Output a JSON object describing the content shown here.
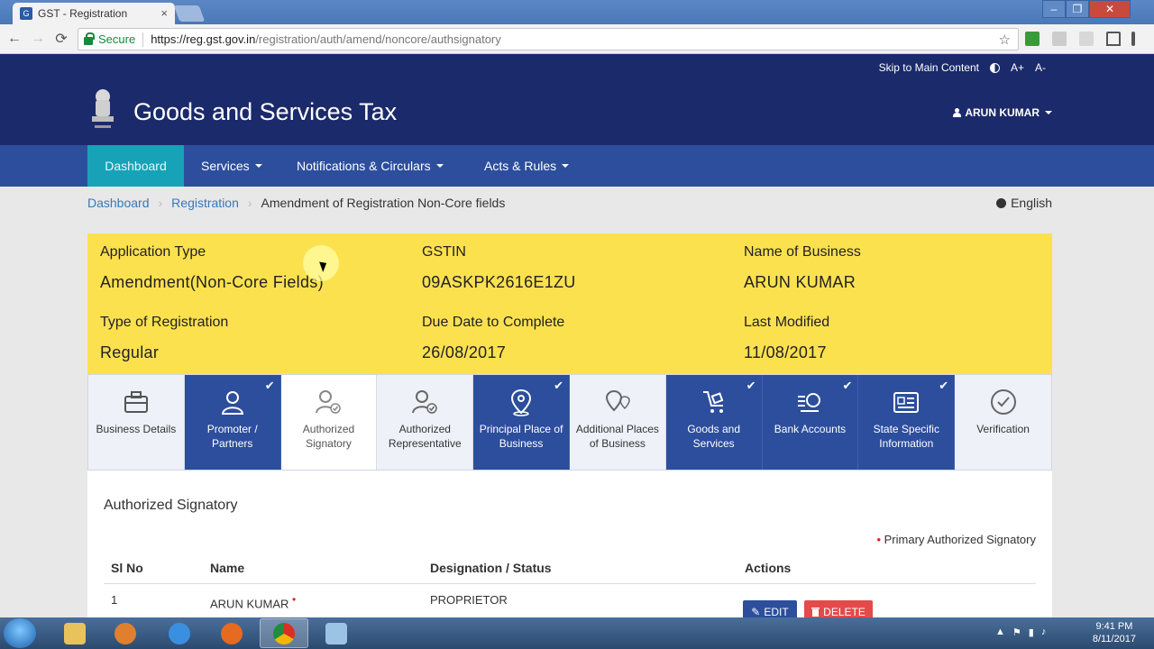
{
  "browser": {
    "tab_title": "GST - Registration",
    "tab_close": "×",
    "secure_label": "Secure",
    "url_host": "https://reg.gst.gov.in",
    "url_path": "/registration/auth/amend/noncore/authsignatory",
    "star": "☆",
    "window_controls": [
      "–",
      "❐",
      "✕"
    ],
    "nav": {
      "back": "←",
      "forward": "→",
      "reload": "⟳"
    }
  },
  "site": {
    "skip_link": "Skip to Main Content",
    "font_increase": "A+",
    "font_decrease": "A-",
    "title": "Goods and Services Tax",
    "user_name": "ARUN KUMAR",
    "nav": [
      {
        "label": "Dashboard",
        "active": true
      },
      {
        "label": "Services",
        "dropdown": true
      },
      {
        "label": "Notifications & Circulars",
        "dropdown": true
      },
      {
        "label": "Acts & Rules",
        "dropdown": true
      }
    ]
  },
  "breadcrumb": {
    "items": [
      "Dashboard",
      "Registration",
      "Amendment of Registration Non-Core fields"
    ],
    "separator": "›"
  },
  "language": "English",
  "summary": {
    "application_type_label": "Application Type",
    "application_type": "Amendment(Non-Core Fields)",
    "gstin_label": "GSTIN",
    "gstin": "09ASKPK2616E1ZU",
    "business_name_label": "Name of Business",
    "business_name": "ARUN KUMAR",
    "registration_type_label": "Type of Registration",
    "registration_type": "Regular",
    "due_date_label": "Due Date to Complete",
    "due_date": "26/08/2017",
    "last_modified_label": "Last Modified",
    "last_modified": "11/08/2017"
  },
  "steps": [
    {
      "label": "Business Details",
      "state": "pending",
      "icon": "briefcase-icon"
    },
    {
      "label": "Promoter / Partners",
      "state": "done",
      "icon": "person-icon"
    },
    {
      "label": "Authorized Signatory",
      "state": "current",
      "icon": "signatory-icon"
    },
    {
      "label": "Authorized Representative",
      "state": "pending",
      "icon": "representative-icon"
    },
    {
      "label": "Principal Place of Business",
      "state": "done",
      "icon": "map-pin-icon"
    },
    {
      "label": "Additional Places of Business",
      "state": "pending",
      "icon": "multi-pin-icon"
    },
    {
      "label": "Goods and Services",
      "state": "done",
      "icon": "cart-icon"
    },
    {
      "label": "Bank Accounts",
      "state": "done",
      "icon": "bank-icon"
    },
    {
      "label": "State Specific Information",
      "state": "done",
      "icon": "id-card-icon"
    },
    {
      "label": "Verification",
      "state": "pending",
      "icon": "check-circle-icon"
    }
  ],
  "check_mark": "✔",
  "panel": {
    "title": "Authorized Signatory",
    "legend_dot": "•",
    "legend_text": "Primary Authorized Signatory",
    "columns": [
      "Sl No",
      "Name",
      "Designation / Status",
      "Actions"
    ],
    "rows": [
      {
        "sl": "1",
        "name": "ARUN KUMAR",
        "primary_marker": "•",
        "designation": "PROPRIETOR"
      }
    ],
    "edit_label": "EDIT",
    "delete_label": "DELETE"
  },
  "taskbar": {
    "time": "9:41 PM",
    "date": "8/11/2017"
  },
  "colors": {
    "header": "#1b2a6b",
    "nav": "#2c4e9c",
    "nav_active": "#17a2b8",
    "summary_bg": "#fce14f",
    "step_done": "#2c4e9c",
    "delete": "#e34b4b"
  }
}
